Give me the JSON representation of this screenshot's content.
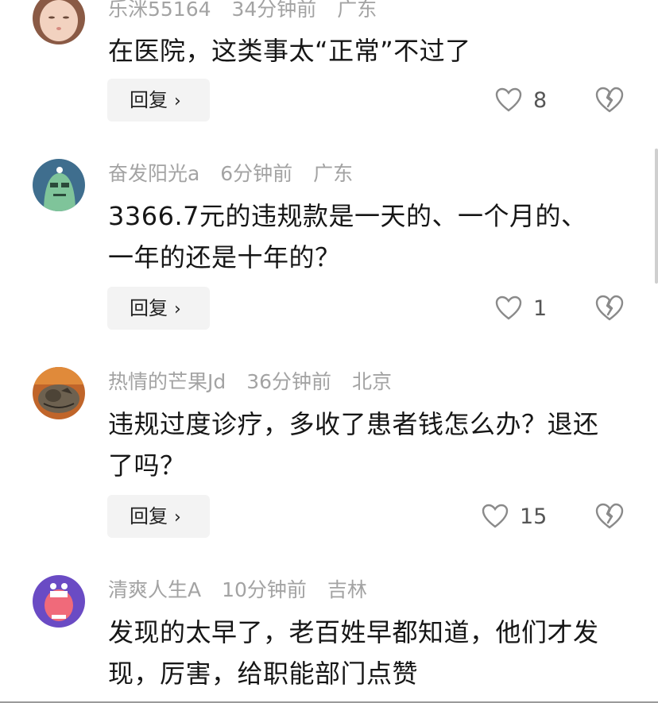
{
  "comments": [
    {
      "username": "乐洣55164",
      "time": "34分钟前",
      "location": "广东",
      "text": "在医院，这类事太“正常”不过了",
      "reply_label": "回复",
      "likes": "8",
      "avatar_icon": "baby-face-avatar"
    },
    {
      "username": "奋发阳光a",
      "time": "6分钟前",
      "location": "广东",
      "text": "3366.7元的违规款是一天的、一个月的、一年的还是十年的？",
      "reply_label": "回复",
      "likes": "1",
      "avatar_icon": "green-cartoon-avatar"
    },
    {
      "username": "热情的芒果Jd",
      "time": "36分钟前",
      "location": "北京",
      "text": "违规过度诊疗，多收了患者钱怎么办？退还了吗？",
      "reply_label": "回复",
      "likes": "15",
      "avatar_icon": "cat-photo-avatar"
    },
    {
      "username": "清爽人生A",
      "time": "10分钟前",
      "location": "吉林",
      "text": "发现的太早了，老百姓早都知道，他们才发现，厉害，给职能部门点赞",
      "avatar_icon": "purple-cartoon-avatar"
    }
  ],
  "colors": {
    "meta_text": "#a3a3a3",
    "body_text": "#161616",
    "reply_bg": "#f3f3f3"
  }
}
